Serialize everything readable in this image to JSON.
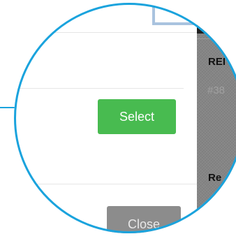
{
  "dialog": {
    "select_label": "Select",
    "close_label": "Close"
  },
  "side_panel": {
    "heading": "REI",
    "id_value": "#38",
    "heading_2": "Re"
  },
  "colors": {
    "highlight_ring": "#1aa3dd",
    "select_button": "#48bb50",
    "close_button": "#8c8c8c",
    "panel_background": "#858585",
    "frame_outline": "#a9c3df"
  }
}
